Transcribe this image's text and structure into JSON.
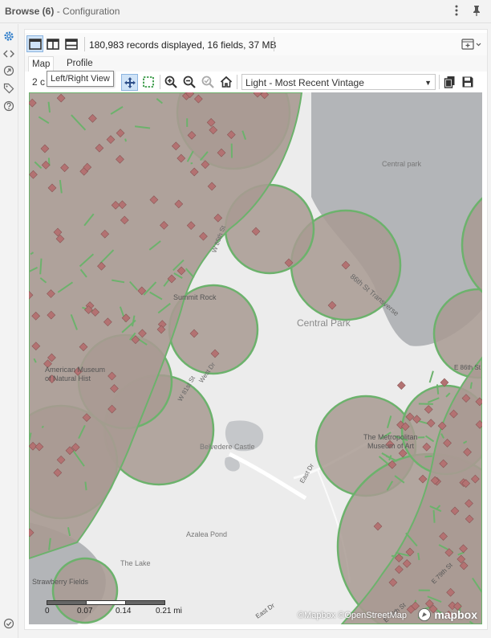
{
  "window": {
    "title_bold": "Browse (6)",
    "title_rest": " - Configuration"
  },
  "toolbar": {
    "records_text": "180,983 records displayed, 16 fields, 37 MB"
  },
  "tabs": [
    {
      "label": "Map",
      "active": true
    },
    {
      "label": "Profile",
      "active": false
    }
  ],
  "map_toolbar": {
    "partial_text": "2 c",
    "tooltip": "Left/Right View",
    "base_style_value": "Light - Most Recent Vintage"
  },
  "map": {
    "labels": {
      "central_park_small": "Central park",
      "central_park": "Central Park",
      "summit_rock": "Summit Rock",
      "amnh_1": "American Museum",
      "amnh_2": "of Natural Hist",
      "belvedere": "Belvedere Castle",
      "met_1": "The Metropolitan",
      "met_2": "Museum of Art",
      "azalea": "Azalea Pond",
      "the_lake": "The Lake",
      "strawberry": "Strawberry Fields",
      "transverse": "86th St Transverse",
      "w85": "W 85th St",
      "w81": "W 81st St",
      "east_dr": "East Dr",
      "west_dr": "West Dr",
      "e79": "E 79th St",
      "e76": "E 76th St",
      "e86": "E 86th St"
    },
    "scale": {
      "ticks": [
        "0",
        "0.07",
        "0.14",
        "0.21 mi"
      ]
    },
    "attribution": "©Mapbox ©OpenStreetMap",
    "logo_text": "mapbox",
    "colors": {
      "cell_fill": "#a89a92",
      "cell_stroke": "#6cb26c",
      "point_fill": "#b37272",
      "water": "#b3b5b8",
      "park": "#ececec"
    }
  }
}
